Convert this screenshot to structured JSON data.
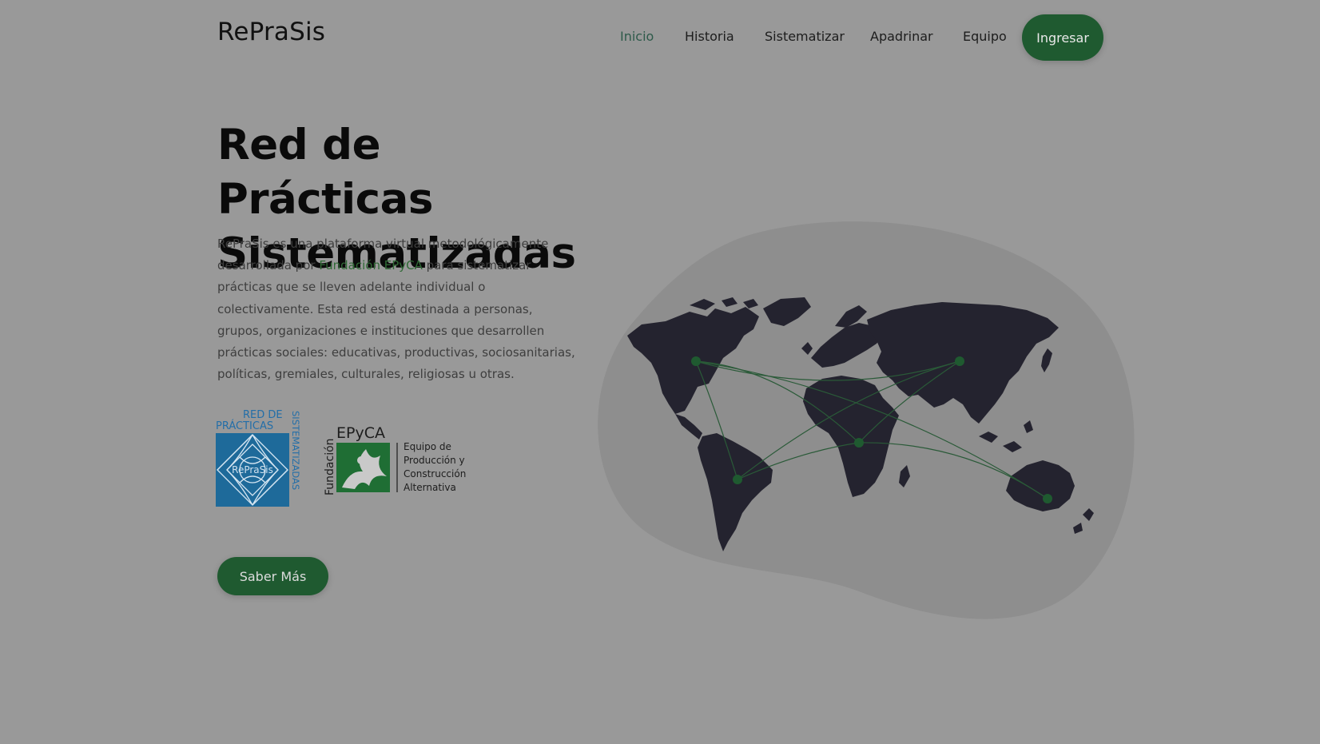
{
  "header": {
    "brand": "RePraSis",
    "nav": [
      {
        "label": "Inicio",
        "active": true
      },
      {
        "label": "Historia",
        "active": false
      },
      {
        "label": "Sistematizar",
        "active": false
      },
      {
        "label": "Apadrinar",
        "active": false
      },
      {
        "label": "Equipo",
        "active": false
      }
    ],
    "login_label": "Ingresar"
  },
  "hero": {
    "title_line1": "Red de Prácticas",
    "title_line2": "Sistematizadas",
    "desc_before": "RePraSis es una plataforma virtual metodológicamente desarrollada por ",
    "desc_link": "Fundación EPyCA",
    "desc_after": " para sistematizar prácticas que se lleven adelante individual o colectivamente. Esta red está destinada a personas, grupos, organizaciones e instituciones que desarrollen prácticas sociales: educativas, productivas, sociosanitarias, políticas, gremiales, culturales, religiosas u otras.",
    "cta_label": "Saber Más"
  },
  "logos": {
    "reprasis": {
      "top_text_1": "RED DE",
      "top_text_2": "PRÁCTICAS",
      "side_text": "SISTEMATIZADAS",
      "center_text": "RePraSis"
    },
    "epyca": {
      "side_text": "Fundación",
      "title": "EPyCA",
      "line1": "Equipo de",
      "line2": "Producción y",
      "line3": "Construcción",
      "line4": "Alternativa"
    }
  },
  "illustration": {
    "icon": "world-network-map",
    "colors": {
      "blob": "#8e8e8e",
      "land": "#24232f",
      "nodes": "#1f5a30",
      "lines": "#2a5a38"
    }
  },
  "colors": {
    "background": "#999999",
    "accent": "#1f5a30",
    "active_nav": "#2e5a4a"
  }
}
